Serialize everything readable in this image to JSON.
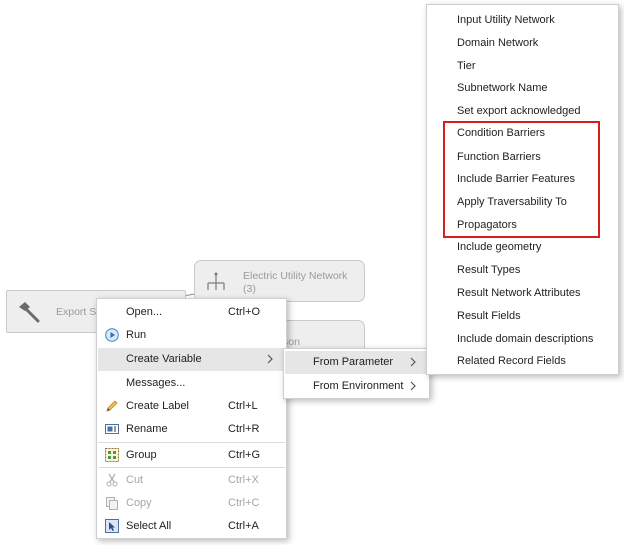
{
  "canvas": {
    "export_node": {
      "label": "Export Su",
      "icon": "hammer-icon"
    },
    "network_node": {
      "title": "Electric Utility Network",
      "count": "(3)",
      "icon": "network-icon"
    },
    "json_node": {
      "label_fragment": "son"
    }
  },
  "context_menu": {
    "items": [
      {
        "label": "Open...",
        "shortcut": "Ctrl+O",
        "icon": ""
      },
      {
        "label": "Run",
        "shortcut": "",
        "icon": "run-icon"
      },
      {
        "label": "Create Variable",
        "shortcut": "",
        "icon": ""
      },
      {
        "label": "Messages...",
        "shortcut": "",
        "icon": ""
      },
      {
        "label": "Create Label",
        "shortcut": "Ctrl+L",
        "icon": "pencil-icon"
      },
      {
        "label": "Rename",
        "shortcut": "Ctrl+R",
        "icon": "rename-icon"
      },
      {
        "label": "Group",
        "shortcut": "Ctrl+G",
        "icon": "group-icon"
      },
      {
        "label": "Cut",
        "shortcut": "Ctrl+X",
        "icon": "scissors-icon"
      },
      {
        "label": "Copy",
        "shortcut": "Ctrl+C",
        "icon": "copy-icon"
      },
      {
        "label": "Select All",
        "shortcut": "Ctrl+A",
        "icon": "select-all-icon"
      }
    ]
  },
  "submenu": {
    "items": [
      {
        "label": "From Parameter"
      },
      {
        "label": "From Environment"
      }
    ]
  },
  "parameter_menu": {
    "items": [
      "Input Utility Network",
      "Domain Network",
      "Tier",
      "Subnetwork Name",
      "Set export acknowledged",
      "Condition Barriers",
      "Function Barriers",
      "Include Barrier Features",
      "Apply Traversability To",
      "Propagators",
      "Include geometry",
      "Result Types",
      "Result Network Attributes",
      "Result Fields",
      "Include domain descriptions",
      "Related Record Fields"
    ],
    "highlight_color": "#d41f1f"
  }
}
